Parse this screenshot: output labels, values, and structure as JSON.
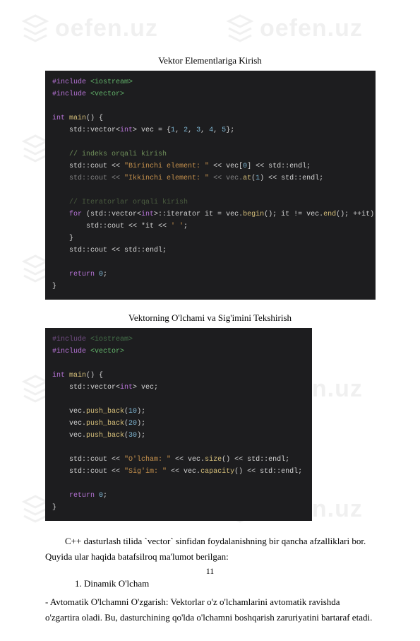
{
  "watermark_text": "oefen.uz",
  "heading1": "Vektor Elementlariga Kirish",
  "heading2": "Vektorning O'lchami va Sig'imini Tekshirish",
  "code1": {
    "l1a": "#include",
    "l1b": " <iostream>",
    "l2a": "#include",
    "l2b": " <vector>",
    "l3a": "int",
    "l3b": " main",
    "l3c": "() {",
    "l4a": "    std::vector<",
    "l4b": "int",
    "l4c": "> vec = {",
    "l4d": "1",
    "l4e": ", ",
    "l4f": "2",
    "l4g": ", ",
    "l4h": "3",
    "l4i": ", ",
    "l4j": "4",
    "l4k": ", ",
    "l4l": "5",
    "l4m": "};",
    "l5": "    // indeks orqali kirish",
    "l6a": "    std::cout << ",
    "l6b": "\"Birinchi element: \"",
    "l6c": " << vec[",
    "l6d": "0",
    "l6e": "] << std::endl;",
    "l7a": "    std::cout << ",
    "l7b": "\"Ikkinchi element: \"",
    "l7c": " << vec.",
    "l7d": "at",
    "l7e": "(",
    "l7f": "1",
    "l7g": ") << std::endl;",
    "l8": "    // Iteratorlar orqali kirish",
    "l9a": "    for",
    "l9b": " (std::vector<",
    "l9c": "int",
    "l9d": ">::iterator it = vec.",
    "l9e": "begin",
    "l9f": "(); it != vec.",
    "l9g": "end",
    "l9h": "(); ++it) {",
    "l10a": "        std::cout << *it << ",
    "l10b": "' '",
    "l10c": ";",
    "l11": "    }",
    "l12": "    std::cout << std::endl;",
    "l13a": "    return",
    "l13b": " ",
    "l13c": "0",
    "l13d": ";",
    "l14": "}"
  },
  "code2": {
    "l1a": "#include",
    "l1b": " <iostream>",
    "l2a": "#include",
    "l2b": " <vector>",
    "l3a": "int",
    "l3b": " main",
    "l3c": "() {",
    "l4a": "    std::vector<",
    "l4b": "int",
    "l4c": "> vec;",
    "l5a": "    vec.",
    "l5b": "push_back",
    "l5c": "(",
    "l5d": "10",
    "l5e": ");",
    "l6a": "    vec.",
    "l6b": "push_back",
    "l6c": "(",
    "l6d": "20",
    "l6e": ");",
    "l7a": "    vec.",
    "l7b": "push_back",
    "l7c": "(",
    "l7d": "30",
    "l7e": ");",
    "l8a": "    std::cout << ",
    "l8b": "\"O'lcham: \"",
    "l8c": " << vec.",
    "l8d": "size",
    "l8e": "() << std::endl;",
    "l9a": "    std::cout << ",
    "l9b": "\"Sig'im: \"",
    "l9c": " << vec.",
    "l9d": "capacity",
    "l9e": "() << std::endl;",
    "l10a": "    return",
    "l10b": " ",
    "l10c": "0",
    "l10d": ";",
    "l11": "}"
  },
  "para1": "C++ dasturlash tilida `vector` sinfidan foydalanishning bir qancha afzalliklari bor. Quyida ular haqida batafsilroq ma'lumot berilgan:",
  "section1_heading": " 1. Dinamik O'lcham",
  "section1_body": "   - Avtomatik O'lchamni O'zgarish: Vektorlar o'z o'lchamlarini avtomatik ravishda o'zgartira oladi. Bu, dasturchining qo'lda o'lchamni boshqarish zaruriyatini bartaraf etadi.",
  "page_number": "11"
}
